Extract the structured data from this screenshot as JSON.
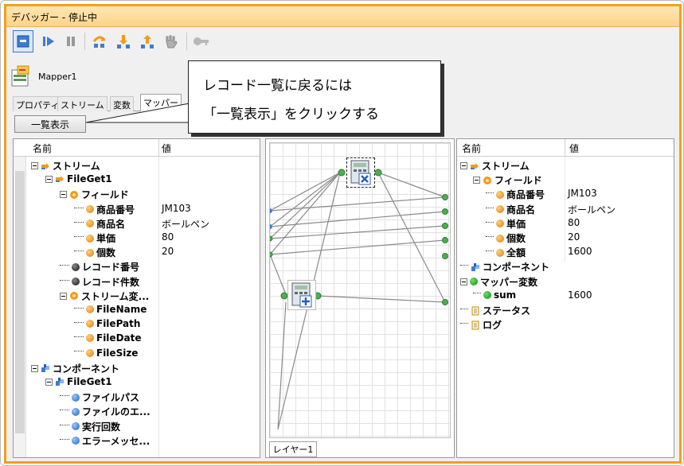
{
  "window": {
    "title": "デバッガー - 停止中"
  },
  "toolbar": {
    "buttons": [
      {
        "icon": "stop-icon",
        "active": true
      },
      {
        "icon": "play-icon"
      },
      {
        "icon": "pause-icon"
      },
      {
        "icon": "step-over-icon"
      },
      {
        "icon": "step-into-icon"
      },
      {
        "icon": "step-out-icon"
      },
      {
        "icon": "breakpoint-hand-icon"
      },
      {
        "icon": "key-icon"
      }
    ]
  },
  "mapper": {
    "label": "Mapper1"
  },
  "tabs": [
    "プロパティ",
    "ストリーム",
    "変数",
    "マッパー"
  ],
  "list_button": "一覧表示",
  "callout": {
    "line1": "レコード一覧に戻るには",
    "line2": "「一覧表示」をクリックする"
  },
  "left_panel": {
    "col_name": "名前",
    "col_value": "値",
    "rows": [
      {
        "name": "ストリーム",
        "value": "",
        "icon": "stream-icon"
      },
      {
        "name": "FileGet1",
        "value": "",
        "icon": "stream-icon"
      },
      {
        "name": "フィールド",
        "value": "",
        "icon": "field-folder-icon"
      },
      {
        "name": "商品番号",
        "value": "JM103",
        "icon": "field-icon"
      },
      {
        "name": "商品名",
        "value": "ボールペン",
        "icon": "field-icon"
      },
      {
        "name": "単価",
        "value": "80",
        "icon": "field-icon"
      },
      {
        "name": "個数",
        "value": "20",
        "icon": "field-icon"
      },
      {
        "name": "レコード番号",
        "value": "",
        "icon": "black-dot-icon"
      },
      {
        "name": "レコード件数",
        "value": "",
        "icon": "black-dot-icon"
      },
      {
        "name": "ストリーム変...",
        "value": "",
        "icon": "field-folder-icon"
      },
      {
        "name": "FileName",
        "value": "",
        "icon": "field-icon"
      },
      {
        "name": "FilePath",
        "value": "",
        "icon": "field-icon"
      },
      {
        "name": "FileDate",
        "value": "",
        "icon": "field-icon"
      },
      {
        "name": "FileSize",
        "value": "",
        "icon": "field-icon"
      },
      {
        "name": "コンポーネント",
        "value": "",
        "icon": "component-icon"
      },
      {
        "name": "FileGet1",
        "value": "",
        "icon": "component-icon"
      },
      {
        "name": "ファイルパス",
        "value": "",
        "icon": "blue-dot-icon"
      },
      {
        "name": "ファイルのエ...",
        "value": "",
        "icon": "blue-dot-icon"
      },
      {
        "name": "実行回数",
        "value": "",
        "icon": "blue-dot-icon"
      },
      {
        "name": "エラーメッセ...",
        "value": "",
        "icon": "blue-dot-icon"
      }
    ]
  },
  "right_panel": {
    "col_name": "名前",
    "col_value": "値",
    "rows": [
      {
        "name": "ストリーム",
        "value": "",
        "icon": "stream-icon"
      },
      {
        "name": "フィールド",
        "value": "",
        "icon": "field-folder-icon"
      },
      {
        "name": "商品番号",
        "value": "JM103",
        "icon": "field-icon"
      },
      {
        "name": "商品名",
        "value": "ボールペン",
        "icon": "field-icon"
      },
      {
        "name": "単価",
        "value": "80",
        "icon": "field-icon"
      },
      {
        "name": "個数",
        "value": "20",
        "icon": "field-icon"
      },
      {
        "name": "全額",
        "value": "1600",
        "icon": "field-icon"
      },
      {
        "name": "コンポーネント",
        "value": "",
        "icon": "component-icon"
      },
      {
        "name": "マッパー変数",
        "value": "",
        "icon": "green-dot-icon"
      },
      {
        "name": "sum",
        "value": "1600",
        "icon": "green-dot-icon"
      },
      {
        "name": "ステータス",
        "value": "",
        "icon": "document-icon"
      },
      {
        "name": "ログ",
        "value": "",
        "icon": "document-icon"
      }
    ]
  },
  "canvas": {
    "layer_tab": "レイヤー1"
  }
}
